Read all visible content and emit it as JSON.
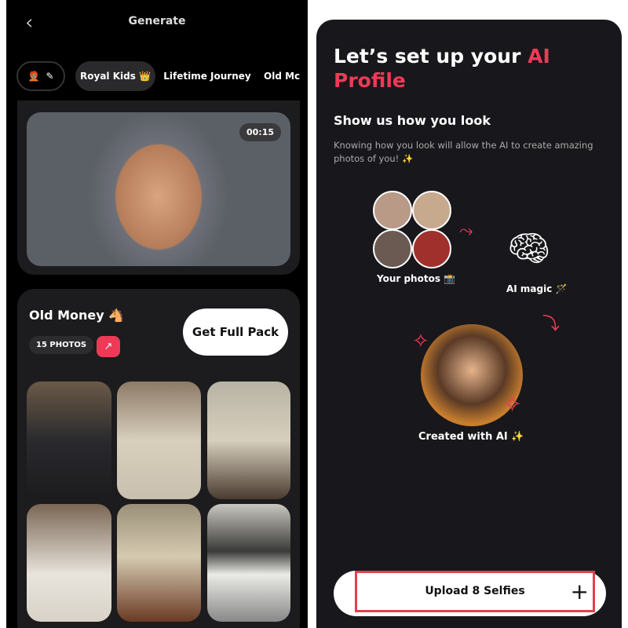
{
  "left": {
    "header": {
      "title": "Generate",
      "back_icon": "chevron-left-icon"
    },
    "chips": [
      {
        "label": "🧑🏽‍🦰",
        "icon": "pencil-icon"
      },
      {
        "label": "Royal Kids 👑"
      },
      {
        "label": "Lifetime Journey"
      },
      {
        "label": "Old Mc"
      }
    ],
    "hero": {
      "duration": "00:15"
    },
    "pack": {
      "title": "Old Money 🐴",
      "count": "15 PHOTOS",
      "trend_icon": "trending-up-icon",
      "cta": "Get Full Pack"
    }
  },
  "right": {
    "title_a": "Let’s set up your ",
    "title_b": "AI",
    "title_c": "Profile",
    "subtitle": "Show us how you look",
    "body": "Knowing how you look will allow the AI to create amazing photos of you! ✨",
    "your_photos": "Your photos 📸",
    "ai_magic": "AI magic 🪄",
    "created": "Created with AI ✨",
    "upload_label": "Upload 8 Selfies",
    "upload_icon": "plus-icon"
  },
  "colors": {
    "accent": "#ee3a57",
    "card": "#1c1c1e",
    "bg": "#000000"
  }
}
